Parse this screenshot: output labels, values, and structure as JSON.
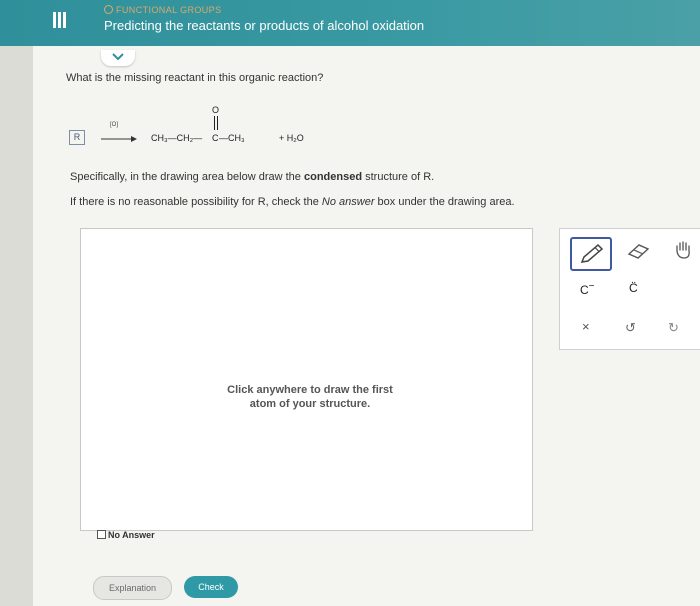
{
  "header": {
    "menu_icon": "menu-icon",
    "topic_label": "FUNCTIONAL GROUPS",
    "title": "Predicting the reactants or products of alcohol oxidation",
    "accent_color": "#2f8f9a"
  },
  "question": {
    "prompt": "What is the missing reactant in this organic reaction?",
    "reactant_label": "R",
    "reagent": "[O]",
    "product_carbonyl_O": "O",
    "product_prefix": "CH₃—CH₂—",
    "product_carbon": "C",
    "product_suffix": "—CH₃",
    "byproduct": "+  H₂O"
  },
  "instructions": {
    "line1_prefix": "Specifically, in the drawing area below draw the ",
    "line1_bold": "condensed",
    "line1_suffix": " structure of R.",
    "line2_prefix": "If there is no reasonable possibility for R, check the ",
    "line2_italic": "No answer",
    "line2_suffix": " box under the drawing area."
  },
  "drawing_area": {
    "hint_line1": "Click anywhere to draw the first",
    "hint_line2": "atom of your structure."
  },
  "no_answer_label": "No Answer",
  "toolbox": {
    "tools": [
      "pencil-icon",
      "eraser-icon",
      "hand-icon",
      "carbanion-icon",
      "carbon-lone-pair-icon",
      "clear-icon",
      "undo-icon",
      "redo-icon"
    ],
    "c_minus": "C",
    "c_minus_sup": "−",
    "c_dots": "C̈",
    "clear": "×",
    "undo": "↺",
    "redo": "↻"
  },
  "buttons": {
    "explanation": "Explanation",
    "check": "Check"
  }
}
